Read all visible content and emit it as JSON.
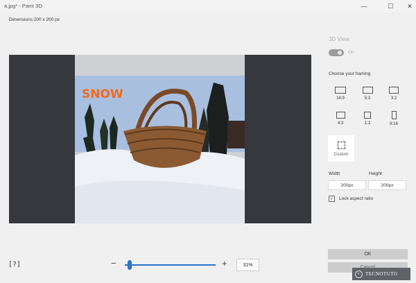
{
  "window": {
    "title": "a.jpg* - Paint 3D",
    "minimize_glyph": "—",
    "maximize_glyph": "☐",
    "close_glyph": "✕"
  },
  "canvas": {
    "dimensions_label": "Dimensions  200 x 200 px",
    "image_overlay_text": "SNOW"
  },
  "toolbar": {
    "fit_icon_glyph": "[?]",
    "zoom_minus": "−",
    "zoom_plus": "+",
    "zoom_level": "31%",
    "zoom_percent": 31
  },
  "panel": {
    "title": "3D View",
    "toggle_label": "On",
    "framing_label": "Choose your framing",
    "framings": [
      {
        "label": "16:9",
        "icon": "rect-16-9-icon"
      },
      {
        "label": "5:3",
        "icon": "rect-5-3-icon"
      },
      {
        "label": "3:2",
        "icon": "rect-3-2-icon"
      },
      {
        "label": "4:3",
        "icon": "rect-4-3-icon"
      },
      {
        "label": "1:1",
        "icon": "square-1-1-icon"
      },
      {
        "label": "9:16",
        "icon": "rect-9-16-icon"
      }
    ],
    "custom_label": "Custom",
    "width_label": "Width",
    "height_label": "Height",
    "width_value": "200px",
    "height_value": "200px",
    "lock_label": "Lock aspect ratio",
    "lock_checked": true,
    "ok_label": "OK",
    "cancel_label": "Cancel"
  },
  "watermark": {
    "text": "TECNOTUTO"
  },
  "colors": {
    "accent": "#2b73c8",
    "canvas_bg": "#36383e",
    "panel_bg": "#f0f0f0"
  }
}
